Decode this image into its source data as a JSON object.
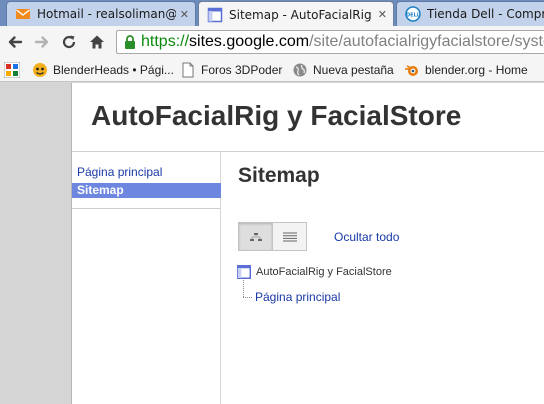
{
  "browser": {
    "tabs": [
      {
        "title": "Hotmail - realsoliman@hot",
        "icon": "hotmail-envelope-icon",
        "active": false,
        "close": "✕"
      },
      {
        "title": "Sitemap - AutoFacialRig y F",
        "icon": "google-sites-page-icon",
        "active": true,
        "close": "✕"
      },
      {
        "title": "Tienda Dell - Compra C",
        "icon": "dell-logo-icon",
        "active": false,
        "close": "✕"
      }
    ],
    "address": {
      "scheme": "https://",
      "host": "sites.google.com",
      "path": "/site/autofacialrigyfacialstore/system"
    },
    "bookmarks": [
      {
        "label": "",
        "icon": "google-apps-icon"
      },
      {
        "label": "BlenderHeads • Pági...",
        "icon": "blenderheads-icon"
      },
      {
        "label": "Foros 3DPoder",
        "icon": "document-icon"
      },
      {
        "label": "Nueva pestaña",
        "icon": "globe-icon"
      },
      {
        "label": "blender.org - Home",
        "icon": "blender-logo-icon"
      }
    ]
  },
  "site": {
    "title": "AutoFacialRig y FacialStore",
    "sidebar": [
      {
        "label": "Página principal",
        "selected": false
      },
      {
        "label": "Sitemap",
        "selected": true
      }
    ],
    "page_heading": "Sitemap",
    "collapse_all": "Ocultar todo",
    "tree": {
      "root": "AutoFacialRig y FacialStore",
      "child": "Página principal"
    }
  },
  "colors": {
    "link": "#1a3aa6",
    "selected_nav": "#6d87e0",
    "secure_scheme": "#0b8a0b",
    "tab_strip": "#6e8cbc"
  }
}
